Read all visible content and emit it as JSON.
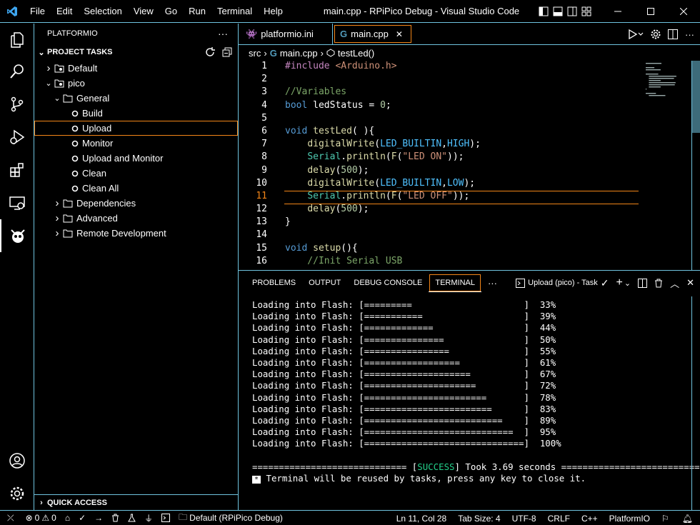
{
  "titlebar": {
    "menus": [
      "File",
      "Edit",
      "Selection",
      "View",
      "Go",
      "Run",
      "Terminal",
      "Help"
    ],
    "title": "main.cpp - RPiPico Debug - Visual Studio Code"
  },
  "sidebar": {
    "header": "PLATFORMIO",
    "section": "PROJECT TASKS",
    "tree": [
      {
        "label": "Default",
        "level": 0,
        "expanded": false,
        "icon": "folder-gear-icon"
      },
      {
        "label": "pico",
        "level": 0,
        "expanded": true,
        "icon": "folder-gear-icon"
      },
      {
        "label": "General",
        "level": 1,
        "expanded": true,
        "icon": "folder-icon"
      },
      {
        "label": "Build",
        "level": 2,
        "icon": "circle-icon"
      },
      {
        "label": "Upload",
        "level": 2,
        "icon": "circle-icon",
        "selected": true
      },
      {
        "label": "Monitor",
        "level": 2,
        "icon": "circle-icon"
      },
      {
        "label": "Upload and Monitor",
        "level": 2,
        "icon": "circle-icon"
      },
      {
        "label": "Clean",
        "level": 2,
        "icon": "circle-icon"
      },
      {
        "label": "Clean All",
        "level": 2,
        "icon": "circle-icon"
      },
      {
        "label": "Dependencies",
        "level": 1,
        "expanded": false,
        "icon": "folder-icon"
      },
      {
        "label": "Advanced",
        "level": 1,
        "expanded": false,
        "icon": "folder-icon"
      },
      {
        "label": "Remote Development",
        "level": 1,
        "expanded": false,
        "icon": "folder-icon"
      }
    ],
    "quick_access": "QUICK ACCESS"
  },
  "editor": {
    "tabs": [
      {
        "label": "platformio.ini",
        "icon": "platformio-icon"
      },
      {
        "label": "main.cpp",
        "icon": "cpp-file-icon",
        "active": true
      }
    ],
    "breadcrumb": [
      "src",
      "main.cpp",
      "testLed()"
    ],
    "current_line": 11,
    "lines": [
      {
        "n": "1",
        "text": "#include <Arduino.h>"
      },
      {
        "n": "2",
        "text": ""
      },
      {
        "n": "3",
        "text": "//Variables"
      },
      {
        "n": "4",
        "text": "bool ledStatus = 0;"
      },
      {
        "n": "5",
        "text": ""
      },
      {
        "n": "6",
        "text": "void testLed( ){"
      },
      {
        "n": "7",
        "text": "    digitalWrite(LED_BUILTIN,HIGH);"
      },
      {
        "n": "8",
        "text": "    Serial.println(F(\"LED ON\"));"
      },
      {
        "n": "9",
        "text": "    delay(500);"
      },
      {
        "n": "10",
        "text": "    digitalWrite(LED_BUILTIN,LOW);"
      },
      {
        "n": "11",
        "text": "    Serial.println(F(\"LED OFF\"));"
      },
      {
        "n": "12",
        "text": "    delay(500);"
      },
      {
        "n": "13",
        "text": "}"
      },
      {
        "n": "14",
        "text": ""
      },
      {
        "n": "15",
        "text": "void setup(){"
      },
      {
        "n": "16",
        "text": "    //Init Serial USB"
      }
    ]
  },
  "panel": {
    "tabs": [
      "PROBLEMS",
      "OUTPUT",
      "DEBUG CONSOLE",
      "TERMINAL"
    ],
    "active_tab": "TERMINAL",
    "task_label": "Upload (pico) - Task",
    "terminal_lines": [
      "Loading into Flash: [=========                     ]  33%",
      "Loading into Flash: [===========                   ]  39%",
      "Loading into Flash: [=============                 ]  44%",
      "Loading into Flash: [===============               ]  50%",
      "Loading into Flash: [================              ]  55%",
      "Loading into Flash: [==================            ]  61%",
      "Loading into Flash: [====================          ]  67%",
      "Loading into Flash: [=====================         ]  72%",
      "Loading into Flash: [=======================       ]  78%",
      "Loading into Flash: [========================      ]  83%",
      "Loading into Flash: [==========================    ]  89%",
      "Loading into Flash: [============================  ]  95%",
      "Loading into Flash: [==============================]  100%",
      ""
    ],
    "success_prefix": "============================= [",
    "success_word": "SUCCESS",
    "success_suffix": "] Took 3.69 seconds =============================",
    "reuse_msg": " Terminal will be reused by tasks, press any key to close it."
  },
  "statusbar": {
    "problems_errors": "0",
    "problems_warnings": "0",
    "env": "Default (RPiPico Debug)",
    "position": "Ln 11, Col 28",
    "tab_size": "Tab Size: 4",
    "encoding": "UTF-8",
    "eol": "CRLF",
    "language": "C++",
    "platformio": "PlatformIO"
  },
  "colors": {
    "border": "#6fc3df",
    "focus": "#f38518",
    "success": "#23d18b"
  }
}
